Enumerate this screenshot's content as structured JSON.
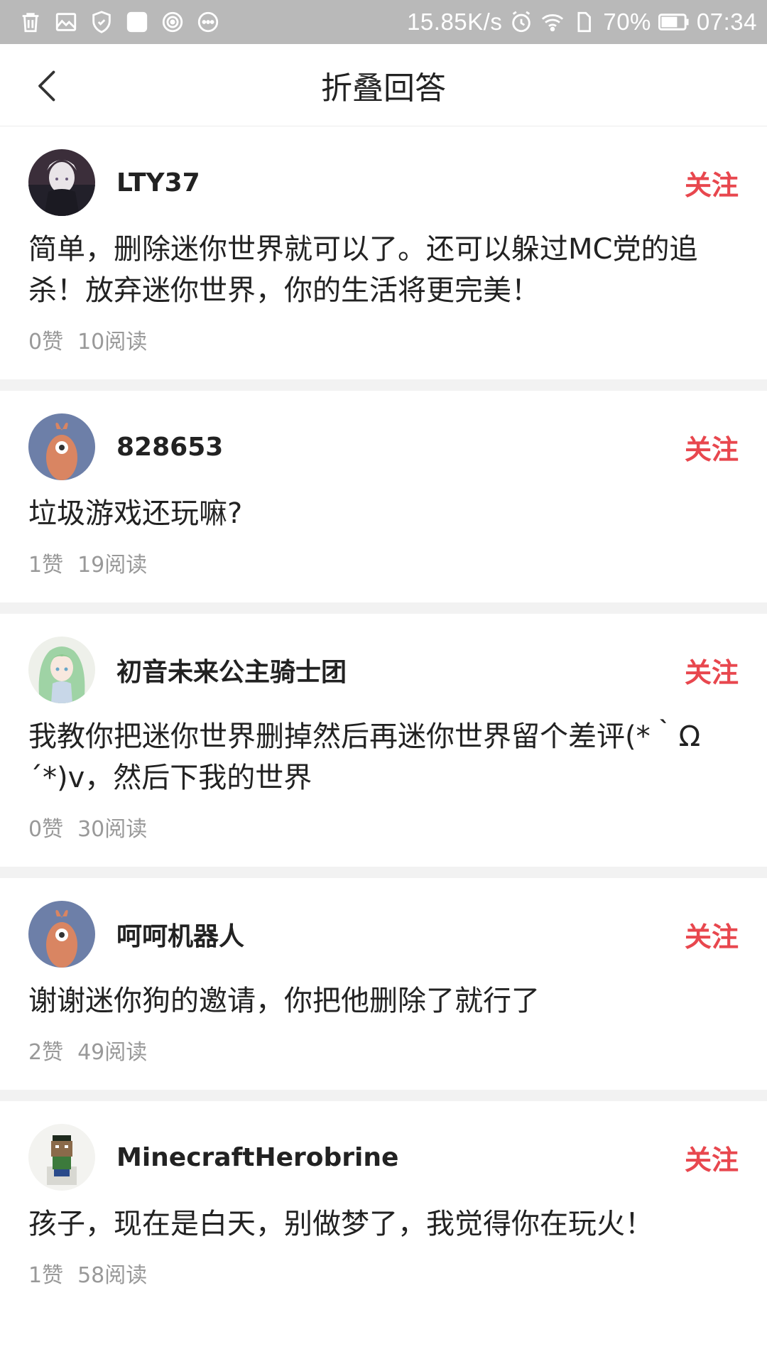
{
  "status_bar": {
    "speed": "15.85K/s",
    "battery": "70%",
    "time": "07:34"
  },
  "header": {
    "title": "折叠回答"
  },
  "colors": {
    "follow": "#e8474e",
    "status_bar_bg": "#b9b9b9",
    "meta_text": "#999999",
    "divider": "#f2f2f2"
  },
  "answers": [
    {
      "username": "LTY37",
      "avatar_icon": "anime-character-avatar",
      "follow_label": "关注",
      "text": "简单，删除迷你世界就可以了。还可以躲过MC党的追杀！放弃迷你世界，你的生活将更完美！",
      "likes": "0赞",
      "reads": "10阅读"
    },
    {
      "username": "828653",
      "avatar_icon": "default-mascot-avatar",
      "follow_label": "关注",
      "text": "垃圾游戏还玩嘛?",
      "likes": "1赞",
      "reads": "19阅读"
    },
    {
      "username": "初音未来公主骑士团",
      "avatar_icon": "green-hair-anime-avatar",
      "follow_label": "关注",
      "text": "我教你把迷你世界删掉然后再迷你世界留个差评(*｀Ω´*)v，然后下我的世界",
      "likes": "0赞",
      "reads": "30阅读"
    },
    {
      "username": "呵呵机器人",
      "avatar_icon": "default-mascot-avatar",
      "follow_label": "关注",
      "text": "谢谢迷你狗的邀请，你把他删除了就行了",
      "likes": "2赞",
      "reads": "49阅读"
    },
    {
      "username": "MinecraftHerobrine",
      "avatar_icon": "minecraft-character-avatar",
      "follow_label": "关注",
      "text": "孩子，现在是白天，别做梦了，我觉得你在玩火！",
      "likes": "1赞",
      "reads": "58阅读"
    }
  ]
}
